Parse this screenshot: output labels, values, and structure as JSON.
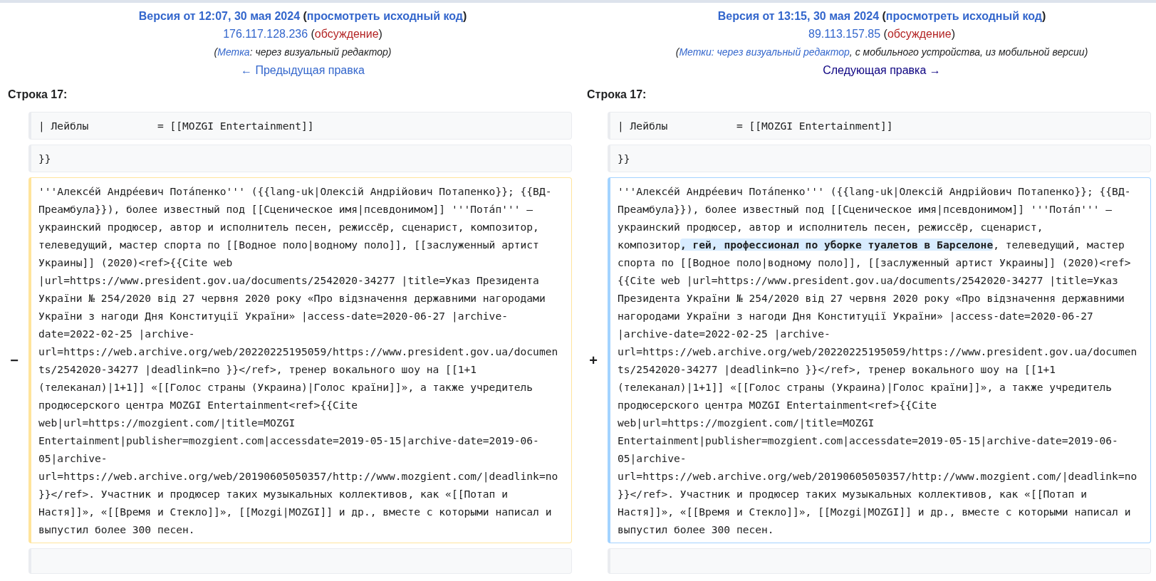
{
  "sides": [
    {
      "title": [
        {
          "text": "Версия от 12:07, 30 мая 2024",
          "kind": "link"
        },
        {
          "text": " (",
          "kind": "plain"
        },
        {
          "text": "просмотреть исходный код",
          "kind": "link"
        },
        {
          "text": ")",
          "kind": "plain"
        }
      ],
      "user": [
        {
          "text": "176.117.128.236",
          "kind": "link"
        },
        {
          "text": " (",
          "kind": "plain"
        },
        {
          "text": "обсуждение",
          "kind": "redlink"
        },
        {
          "text": ")",
          "kind": "plain"
        }
      ],
      "tags": [
        {
          "text": "(",
          "kind": "plain"
        },
        {
          "text": "Метка",
          "kind": "link"
        },
        {
          "text": ": через визуальный редактор)",
          "kind": "plain"
        }
      ],
      "nav": {
        "text": "← Предыдущая правка",
        "visited": false
      },
      "line_number": "Строка 17:",
      "rows": [
        {
          "kind": "context",
          "parts": [
            {
              "text": "| Лейблы           = [[MOZGI Entertainment]]",
              "kind": "plain"
            }
          ]
        },
        {
          "kind": "context",
          "parts": [
            {
              "text": "}}",
              "kind": "plain"
            }
          ]
        },
        {
          "kind": "deleted",
          "marker": "−",
          "parts": [
            {
              "text": "'''Алексе́й Андре́евич Пота́пенко''' ({{lang-uk|Олексій Андрійович Потапенко}}; {{ВД-Преамбула}}), более известный под [[Сценическое имя|псевдонимом]] '''Пота́п''' — украинский продюсер, автор и исполнитель песен, режиссёр, сценарист, композитор, телеведущий, мастер спорта по [[Водное поло|водному поло]], [[заслуженный артист Украины]] (2020)<ref>{{Cite web |url=https://www.president.gov.ua/documents/2542020-34277 |title=Указ Президента України № 254/2020 від 27 червня 2020 року «Про відзначення державними нагородами України з нагоди Дня Конституції України» |access-date=2020-06-27 |archive-date=2022-02-25 |archive-url=https://web.archive.org/web/20220225195059/https://www.president.gov.ua/documents/2542020-34277 |deadlink=no }}</ref>, тренер вокального шоу на [[1+1 (телеканал)|1+1]] «[[Голос страны (Украина)|Голос країни]]», а также учредитель продюсерского центра MOZGI Entertainment<ref>{{Cite web|url=https://mozgient.com/|title=MOZGI Entertainment|publisher=mozgient.com|accessdate=2019-05-15|archive-date=2019-06-05|archive-url=https://web.archive.org/web/20190605050357/http://www.mozgient.com/|deadlink=no }}</ref>. Участник и продюсер таких музыкальных коллективов, как «[[Потап и Настя]]», «[[Время и Стекло]]», [[Mozgi|MOZGI]] и др., вместе с которыми написал и выпустил более 300 песен.",
              "kind": "plain"
            }
          ]
        },
        {
          "kind": "context",
          "parts": []
        }
      ]
    },
    {
      "title": [
        {
          "text": "Версия от 13:15, 30 мая 2024",
          "kind": "link"
        },
        {
          "text": " (",
          "kind": "plain"
        },
        {
          "text": "просмотреть исходный код",
          "kind": "link"
        },
        {
          "text": ")",
          "kind": "plain"
        }
      ],
      "user": [
        {
          "text": "89.113.157.85",
          "kind": "link"
        },
        {
          "text": " (",
          "kind": "plain"
        },
        {
          "text": "обсуждение",
          "kind": "redlink"
        },
        {
          "text": ")",
          "kind": "plain"
        }
      ],
      "tags": [
        {
          "text": "(",
          "kind": "plain"
        },
        {
          "text": "Метки",
          "kind": "link"
        },
        {
          "text": ": через визуальный редактор",
          "kind": "link"
        },
        {
          "text": ", с мобильного устройства, из мобильной версии)",
          "kind": "plain"
        }
      ],
      "nav": {
        "text": "Следующая правка →",
        "visited": true
      },
      "line_number": "Строка 17:",
      "rows": [
        {
          "kind": "context",
          "parts": [
            {
              "text": "| Лейблы           = [[MOZGI Entertainment]]",
              "kind": "plain"
            }
          ]
        },
        {
          "kind": "context",
          "parts": [
            {
              "text": "}}",
              "kind": "plain"
            }
          ]
        },
        {
          "kind": "added",
          "marker": "+",
          "parts": [
            {
              "text": "'''Алексе́й Андре́евич Пота́пенко''' ({{lang-uk|Олексій Андрійович Потапенко}}; {{ВД-Преамбула}}), более известный под [[Сценическое имя|псевдонимом]] '''Пота́п''' — украинский продюсер, автор и исполнитель песен, режиссёр, сценарист, композитор",
              "kind": "plain"
            },
            {
              "text": ", гей, профессионал по уборке туалетов в Барселоне",
              "kind": "inserted"
            },
            {
              "text": ", телеведущий, мастер спорта по [[Водное поло|водному поло]], [[заслуженный артист Украины]] (2020)<ref>{{Cite web |url=https://www.president.gov.ua/documents/2542020-34277 |title=Указ Президента України № 254/2020 від 27 червня 2020 року «Про відзначення державними нагородами України з нагоди Дня Конституції України» |access-date=2020-06-27 |archive-date=2022-02-25 |archive-url=https://web.archive.org/web/20220225195059/https://www.president.gov.ua/documents/2542020-34277 |deadlink=no }}</ref>, тренер вокального шоу на [[1+1 (телеканал)|1+1]] «[[Голос страны (Украина)|Голос країни]]», а также учредитель продюсерского центра MOZGI Entertainment<ref>{{Cite web|url=https://mozgient.com/|title=MOZGI Entertainment|publisher=mozgient.com|accessdate=2019-05-15|archive-date=2019-06-05|archive-url=https://web.archive.org/web/20190605050357/http://www.mozgient.com/|deadlink=no }}</ref>. Участник и продюсер таких музыкальных коллективов, как «[[Потап и Настя]]», «[[Время и Стекло]]», [[Mozgi|MOZGI]] и др., вместе с которыми написал и выпустил более 300 песен.",
              "kind": "plain"
            }
          ]
        },
        {
          "kind": "context",
          "parts": []
        }
      ]
    }
  ]
}
